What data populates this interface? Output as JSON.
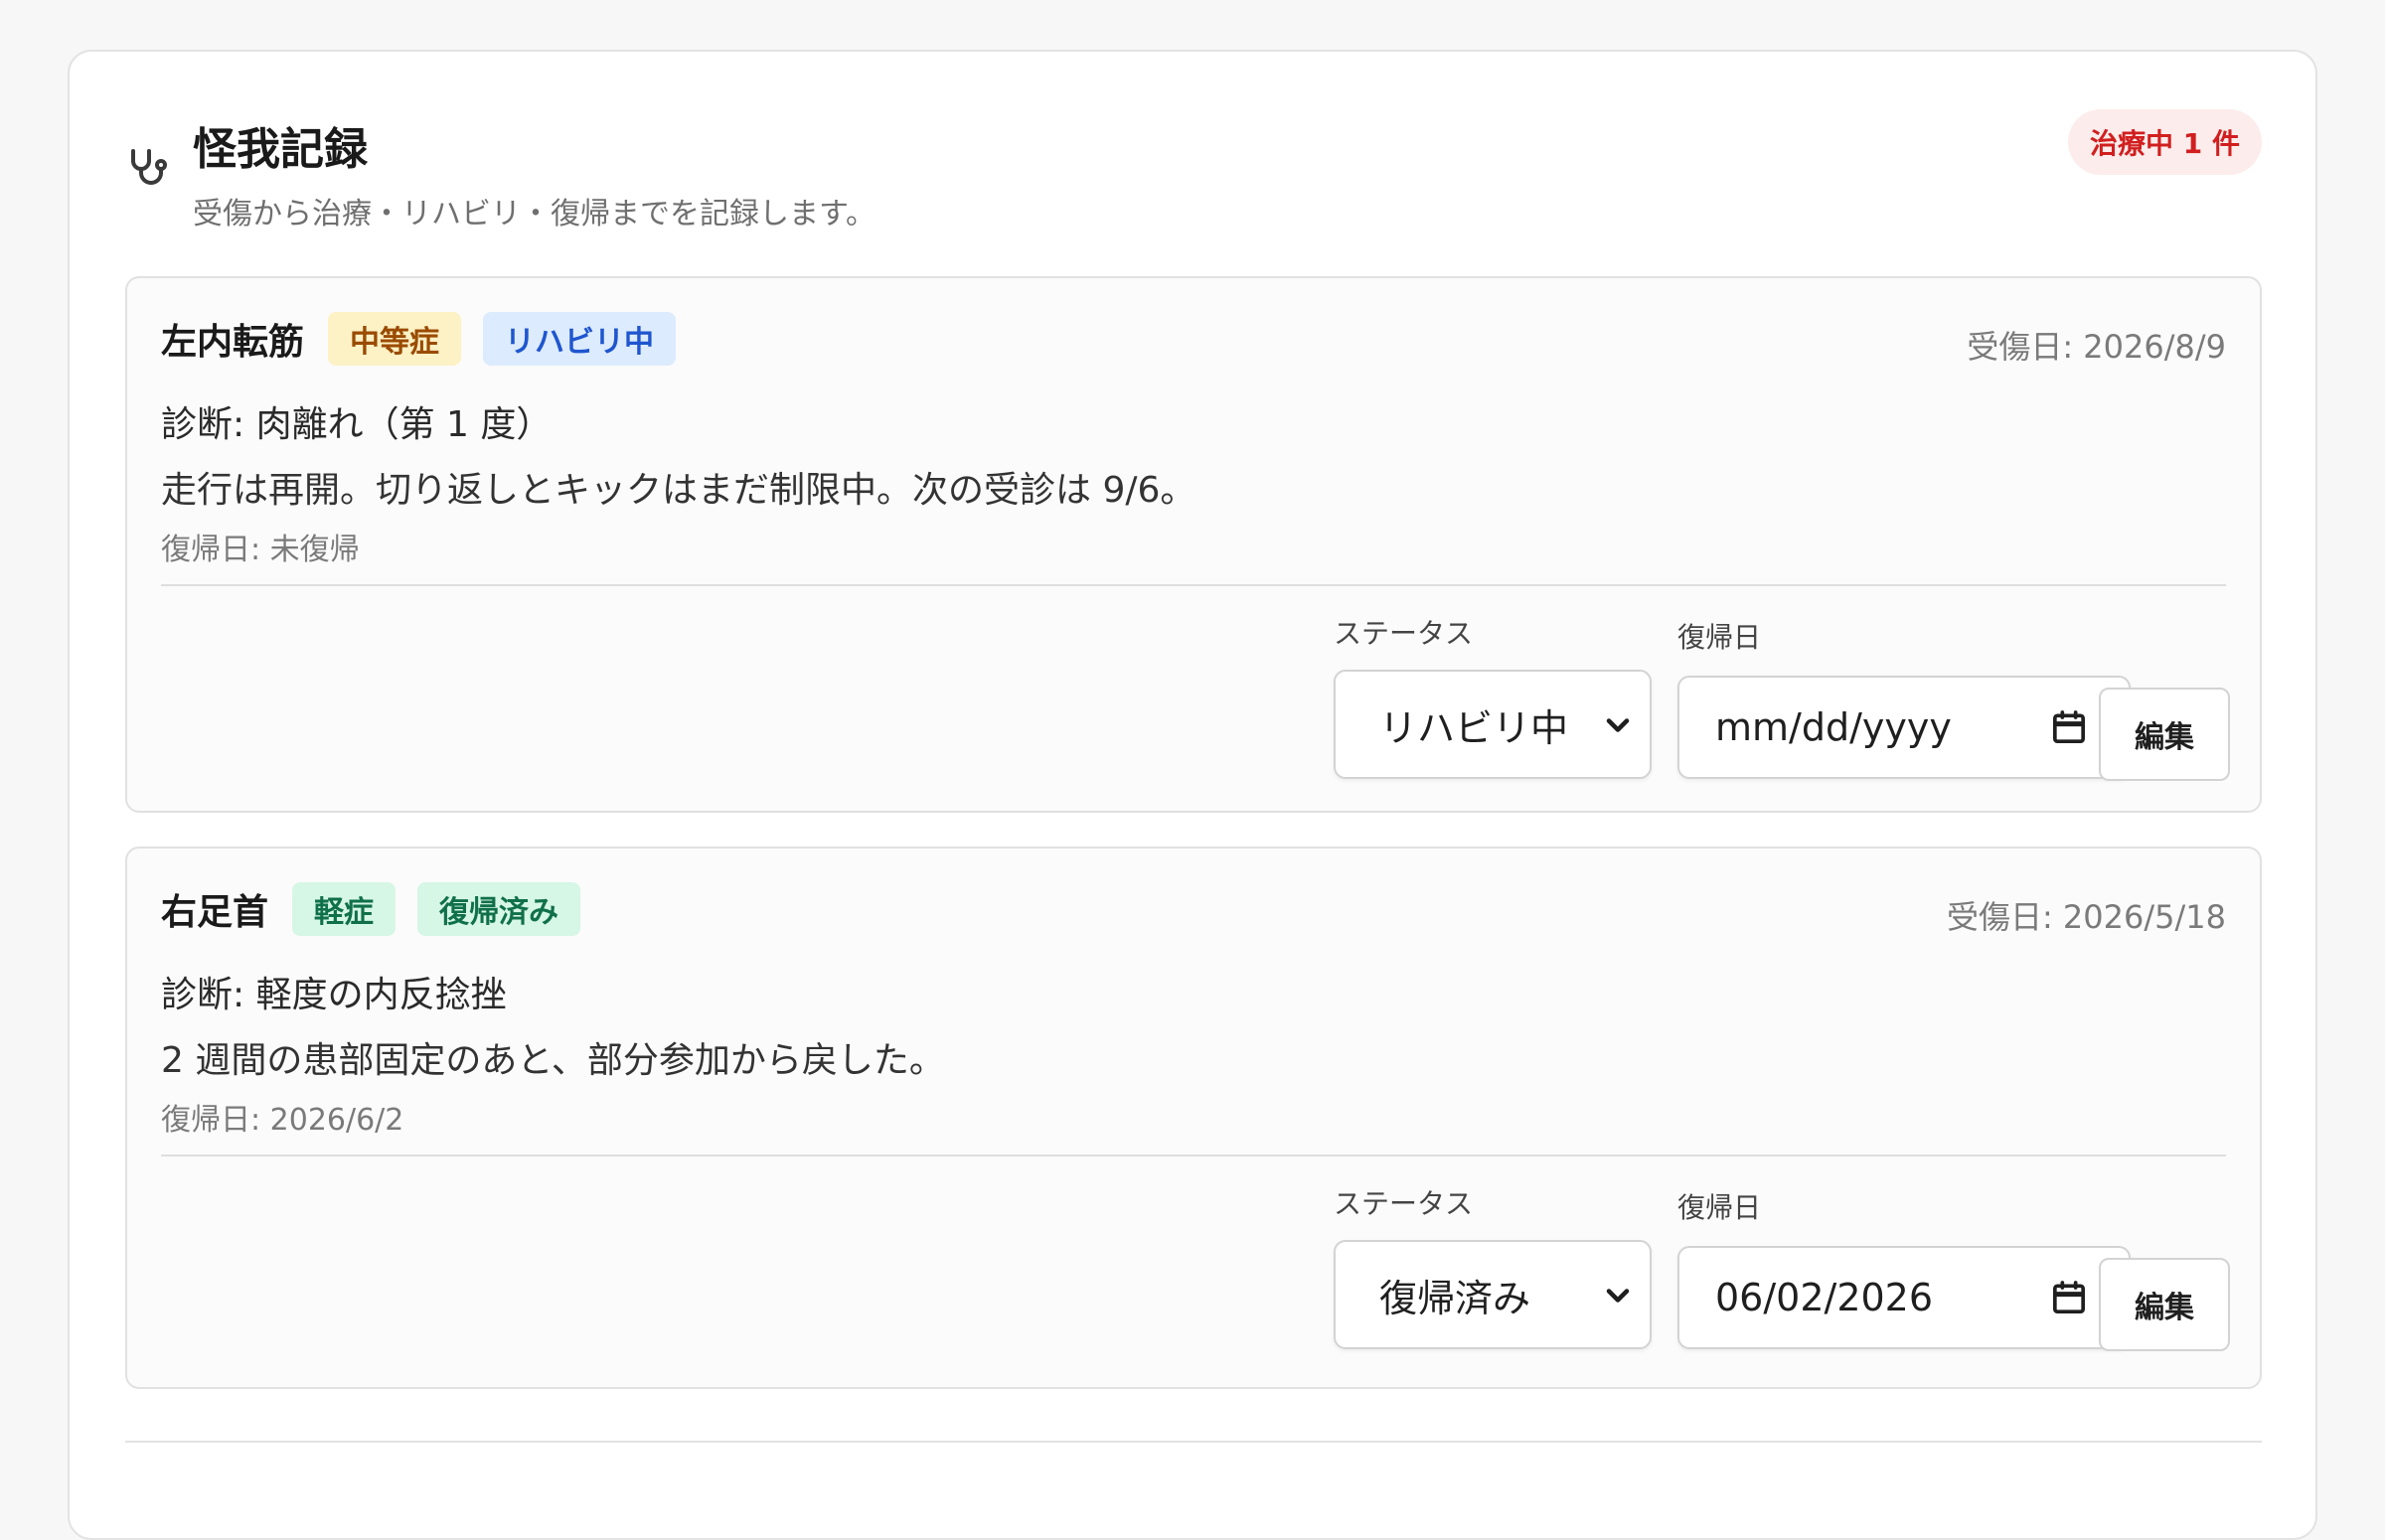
{
  "header": {
    "icon": "stethoscope-icon",
    "title": "怪我記録",
    "subtitle": "受傷から治療・リハビリ・復帰までを記録します。",
    "count_badge": "治療中 1 件"
  },
  "colors": {
    "count_badge_bg": "#fdecec",
    "count_badge_text": "#d11f1f",
    "moderate_bg": "#fdf1c6",
    "moderate_text": "#9a4b00",
    "rehab_bg": "#dcebfd",
    "rehab_text": "#1f56cf",
    "mild_bg": "#d6f6e6",
    "mild_text": "#10704a"
  },
  "injuries": [
    {
      "body_part": "左内転筋",
      "severity": "中等症",
      "status_tag": "リハビリ中",
      "injury_date": "受傷日: 2026/8/9",
      "diagnosis": "診断: 肉離れ（第 1 度）",
      "note": "走行は再開。切り返しとキックはまだ制限中。次の受診は 9/6。",
      "return_line": "復帰日: 未復帰",
      "status_label": "ステータス",
      "status_value": "リハビリ中",
      "return_label": "復帰日",
      "return_value": "mm/dd/yyyy",
      "edit_label": "編集"
    },
    {
      "body_part": "右足首",
      "severity": "軽症",
      "status_tag": "復帰済み",
      "injury_date": "受傷日: 2026/5/18",
      "diagnosis": "診断: 軽度の内反捻挫",
      "note": "2 週間の患部固定のあと、部分参加から戻した。",
      "return_line": "復帰日: 2026/6/2",
      "status_label": "ステータス",
      "status_value": "復帰済み",
      "return_label": "復帰日",
      "return_value": "06/02/2026",
      "edit_label": "編集"
    }
  ]
}
